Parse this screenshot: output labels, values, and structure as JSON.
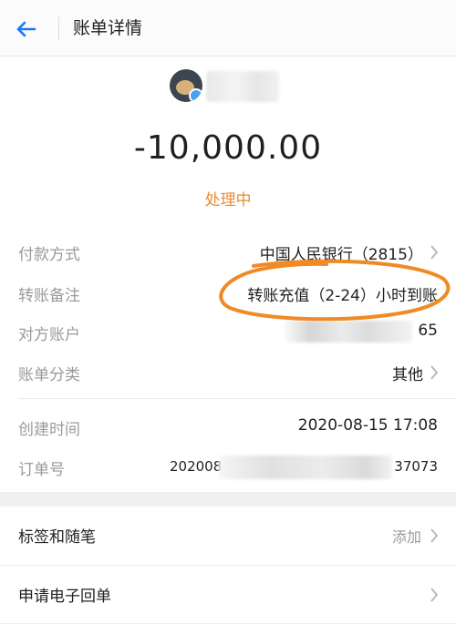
{
  "header": {
    "title": "账单详情"
  },
  "payee": {
    "avatar_icon": "user-avatar"
  },
  "amount": "-10,000.00",
  "status": "处理中",
  "colors": {
    "status": "#e98a2f",
    "accent": "#1677ff",
    "annotation": "#f08a24"
  },
  "details": [
    {
      "label": "付款方式",
      "value": "中国人民银行（2815）"
    },
    {
      "label": "转账备注",
      "value": "转账充值（2-24）小时到账"
    },
    {
      "label": "对方账户",
      "value": "65"
    },
    {
      "label": "账单分类",
      "value": "其他"
    },
    {
      "label": "创建时间",
      "value": "2020-08-15 17:08"
    },
    {
      "label": "订单号",
      "value_start": "202008",
      "value_end": "37073"
    }
  ],
  "actions": [
    {
      "label": "标签和随笔",
      "hint": "添加"
    },
    {
      "label": "申请电子回单"
    }
  ]
}
